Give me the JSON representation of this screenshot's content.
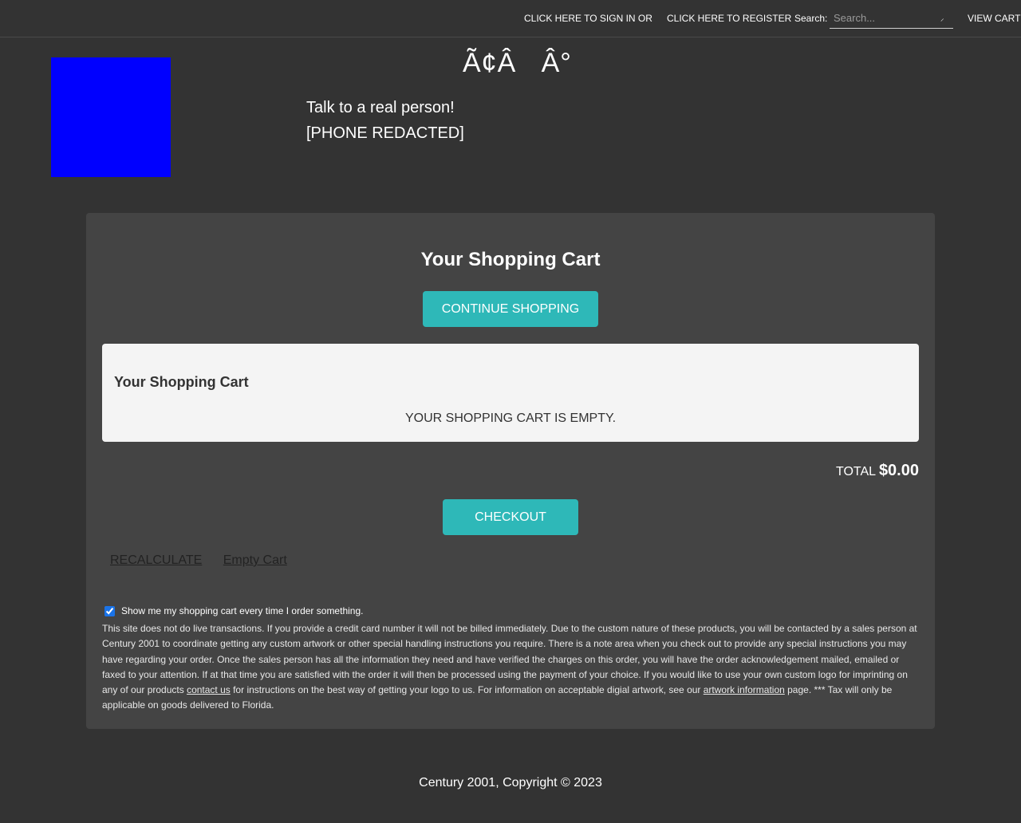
{
  "topbar": {
    "sign_in": "CLICK HERE TO SIGN IN OR",
    "register": "CLICK HERE TO REGISTER",
    "search_label": "Search:",
    "search_placeholder": "Search...",
    "view_cart": "VIEW CART"
  },
  "header": {
    "glyphs": "Ã¢Â   Â°",
    "talk_line": "Talk to a real person!",
    "phone": "[PHONE REDACTED]"
  },
  "cart": {
    "title": "Your Shopping Cart",
    "continue_label": "CONTINUE SHOPPING",
    "box_title": "Your Shopping Cart",
    "empty_message": "YOUR SHOPPING CART IS EMPTY.",
    "total_label": "TOTAL",
    "total_amount": "$0.00",
    "checkout_label": "CHECKOUT",
    "recalculate_label": "RECALCULATE",
    "empty_cart_label": "Empty Cart",
    "pref_checked": true,
    "pref_label": "Show me my shopping cart every time I order something.",
    "notice_part1": "This site does not do live transactions. If you provide a credit card number it will not be billed immediately. Due to the custom nature of these products, you will be contacted by a sales person at Century 2001 to coordinate getting any custom artwork or other special handling instructions you require. There is a note area when you check out to provide any special instructions you may have regarding your order. Once the sales person has all the information they need and have verified the charges on this order, you will have the order acknowledgement mailed, emailed or faxed to your attention. If at that time you are satisfied with the order it will then be processed using the payment of your choice. If you would like to use your own custom logo for imprinting on any of our products ",
    "contact_link": "contact us",
    "notice_part2": " for instructions on the best way of getting your logo to us. For information on acceptable digial artwork, see our ",
    "artwork_link": "artwork information",
    "notice_part3": " page. *** Tax will only be applicable on goods delivered to Florida."
  },
  "footer": {
    "copyright": "Century 2001, Copyright © 2023"
  },
  "colors": {
    "background": "#333333",
    "panel": "#444444",
    "accent": "#2eb8b8",
    "logo": "#0000ff"
  }
}
